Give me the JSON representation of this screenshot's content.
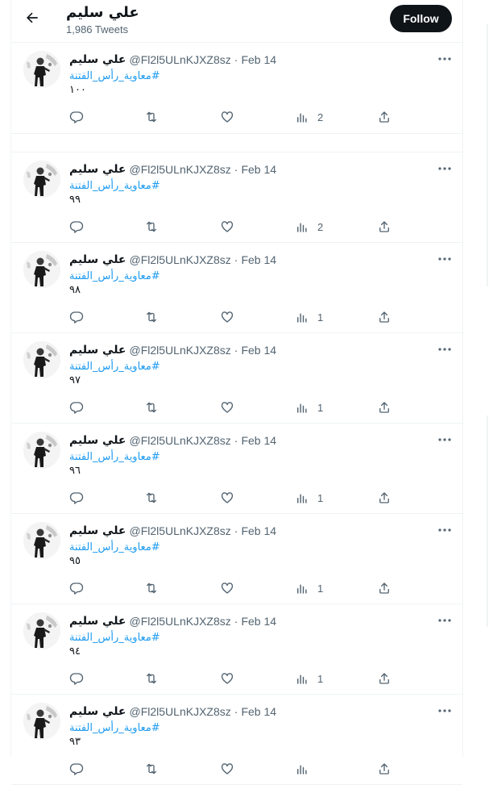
{
  "header": {
    "title": "علي سليم",
    "tweet_count": "1,986 Tweets",
    "follow_label": "Follow"
  },
  "tweets": [
    {
      "name": "علي سليم",
      "handle": "@Fl2l5ULnKJXZ8sz",
      "date": "Feb 14",
      "hashtag": "#معاوية_رأس_الفتنة",
      "text": "١٠٠",
      "views": "2"
    },
    {
      "name": "علي سليم",
      "handle": "@Fl2l5ULnKJXZ8sz",
      "date": "Feb 14",
      "hashtag": "#معاوية_رأس_الفتنة",
      "text": "٩٩",
      "views": "2"
    },
    {
      "name": "علي سليم",
      "handle": "@Fl2l5ULnKJXZ8sz",
      "date": "Feb 14",
      "hashtag": "#معاوية_رأس_الفتنة",
      "text": "٩٨",
      "views": "1"
    },
    {
      "name": "علي سليم",
      "handle": "@Fl2l5ULnKJXZ8sz",
      "date": "Feb 14",
      "hashtag": "#معاوية_رأس_الفتنة",
      "text": "٩٧",
      "views": "1"
    },
    {
      "name": "علي سليم",
      "handle": "@Fl2l5ULnKJXZ8sz",
      "date": "Feb 14",
      "hashtag": "#معاوية_رأس_الفتنة",
      "text": "٩٦",
      "views": "1"
    },
    {
      "name": "علي سليم",
      "handle": "@Fl2l5ULnKJXZ8sz",
      "date": "Feb 14",
      "hashtag": "#معاوية_رأس_الفتنة",
      "text": "٩٥",
      "views": "1"
    },
    {
      "name": "علي سليم",
      "handle": "@Fl2l5ULnKJXZ8sz",
      "date": "Feb 14",
      "hashtag": "#معاوية_رأس_الفتنة",
      "text": "٩٤",
      "views": "1"
    },
    {
      "name": "علي سليم",
      "handle": "@Fl2l5ULnKJXZ8sz",
      "date": "Feb 14",
      "hashtag": "#معاوية_رأس_الفتنة",
      "text": "٩٣",
      "views": ""
    }
  ],
  "colors": {
    "accent": "#1d9bf0",
    "text": "#0f1419",
    "muted": "#536471",
    "border": "#eff3f4"
  },
  "icons": {
    "back": "arrow-left-icon",
    "more": "more-dots-icon",
    "reply": "reply-icon",
    "retweet": "retweet-icon",
    "like": "heart-icon",
    "views": "views-chart-icon",
    "share": "share-icon"
  }
}
